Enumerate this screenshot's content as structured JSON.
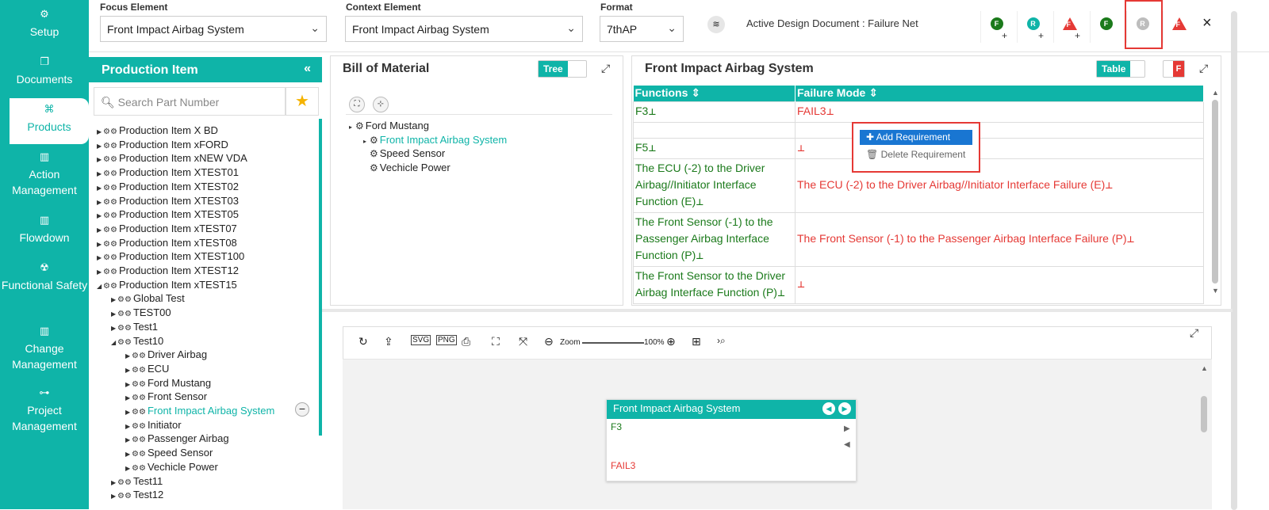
{
  "nav": {
    "items": [
      {
        "label": "Setup",
        "icon": "cogs-icon"
      },
      {
        "label": "Documents",
        "icon": "documents-icon"
      },
      {
        "label": "Products",
        "icon": "products-icon"
      },
      {
        "label": "Action Management",
        "icon": "building-icon"
      },
      {
        "label": "Flowdown",
        "icon": "building-icon"
      },
      {
        "label": "Functional Safety",
        "icon": "safety-icon"
      },
      {
        "label": "Change Management",
        "icon": "building-icon"
      },
      {
        "label": "Project Management",
        "icon": "network-icon"
      }
    ]
  },
  "topbar": {
    "focus_label": "Focus Element",
    "focus_value": "Front Impact Airbag System",
    "context_label": "Context Element",
    "context_value": "Front Impact Airbag System",
    "format_label": "Format",
    "format_value": "7thAP",
    "active_doc": "Active Design Document : Failure Net",
    "buttons": [
      {
        "letter": "F",
        "color": "#1b7a1b",
        "kind": "circle",
        "plus": "+"
      },
      {
        "letter": "R",
        "color": "#0fb4a8",
        "kind": "circle",
        "plus": "+"
      },
      {
        "letter": "F",
        "color": "#e53935",
        "kind": "triangle",
        "plus": "+"
      },
      {
        "letter": "F",
        "color": "#1b7a1b",
        "kind": "circle",
        "plus": ""
      },
      {
        "letter": "R",
        "color": "#bdbdbd",
        "kind": "circle",
        "plus": ""
      },
      {
        "letter": "F",
        "color": "#e53935",
        "kind": "triangle",
        "plus": ""
      }
    ],
    "close": "×"
  },
  "production": {
    "title": "Production Item",
    "collapse": "«",
    "search_placeholder": "Search Part Number",
    "tree": [
      {
        "label": "Production Item X BD",
        "level": 0,
        "expanded": false
      },
      {
        "label": "Production Item xFORD",
        "level": 0,
        "expanded": false
      },
      {
        "label": "Production Item xNEW VDA",
        "level": 0,
        "expanded": false
      },
      {
        "label": "Production Item XTEST01",
        "level": 0,
        "expanded": false
      },
      {
        "label": "Production Item XTEST02",
        "level": 0,
        "expanded": false
      },
      {
        "label": "Production Item XTEST03",
        "level": 0,
        "expanded": false
      },
      {
        "label": "Production Item XTEST05",
        "level": 0,
        "expanded": false
      },
      {
        "label": "Production Item xTEST07",
        "level": 0,
        "expanded": false
      },
      {
        "label": "Production Item xTEST08",
        "level": 0,
        "expanded": false
      },
      {
        "label": "Production Item XTEST100",
        "level": 0,
        "expanded": false
      },
      {
        "label": "Production Item XTEST12",
        "level": 0,
        "expanded": false
      },
      {
        "label": "Production Item xTEST15",
        "level": 0,
        "expanded": true
      },
      {
        "label": "Global Test",
        "level": 1,
        "expanded": false
      },
      {
        "label": "TEST00",
        "level": 1,
        "expanded": false
      },
      {
        "label": "Test1",
        "level": 1,
        "expanded": false
      },
      {
        "label": "Test10",
        "level": 1,
        "expanded": true
      },
      {
        "label": "Driver Airbag",
        "level": 2,
        "expanded": false
      },
      {
        "label": "ECU",
        "level": 2,
        "expanded": false
      },
      {
        "label": "Ford Mustang",
        "level": 2,
        "expanded": false
      },
      {
        "label": "Front Sensor",
        "level": 2,
        "expanded": false
      },
      {
        "label": "Front Impact Airbag System",
        "level": 2,
        "expanded": false,
        "selected": true
      },
      {
        "label": "Initiator",
        "level": 2,
        "expanded": false
      },
      {
        "label": "Passenger Airbag",
        "level": 2,
        "expanded": false
      },
      {
        "label": "Speed Sensor",
        "level": 2,
        "expanded": false
      },
      {
        "label": "Vechicle Power",
        "level": 2,
        "expanded": false
      },
      {
        "label": "Test11",
        "level": 1,
        "expanded": false
      },
      {
        "label": "Test12",
        "level": 1,
        "expanded": false
      }
    ]
  },
  "bom": {
    "title": "Bill of Material",
    "toggle_label": "Tree",
    "tree": [
      {
        "label": "Ford Mustang",
        "level": 0
      },
      {
        "label": "Front Impact Airbag System",
        "level": 1,
        "selected": true
      },
      {
        "label": "Speed Sensor",
        "level": 1
      },
      {
        "label": "Vechicle Power",
        "level": 1
      }
    ]
  },
  "fn": {
    "title": "Front Impact Airbag System",
    "toggle_label": "Table",
    "flag": "F",
    "headers": [
      "Functions",
      "Failure Mode"
    ],
    "rows": [
      {
        "function": "F3",
        "failure": "FAIL3"
      },
      {
        "function": "",
        "failure": ""
      },
      {
        "function": "F5",
        "failure": ""
      },
      {
        "function": "The ECU (-2) to the Driver Airbag//Initiator Interface Function (E)",
        "failure": "The ECU (-2) to the Driver Airbag//Initiator Interface Failure (E)"
      },
      {
        "function": "The Front Sensor (-1) to the Passenger Airbag Interface Function (P)",
        "failure": "The Front Sensor (-1) to the Passenger Airbag Interface Failure (P)"
      },
      {
        "function": "The Front Sensor to the Driver Airbag Interface Function (P)",
        "failure": ""
      }
    ],
    "context_menu": {
      "add": "Add Requirement",
      "delete": "Delete Requirement"
    }
  },
  "net": {
    "zoom_label": "Zoom",
    "zoom_value": "100%",
    "node": {
      "title": "Front Impact Airbag System",
      "function": "F3",
      "failure": "FAIL3"
    }
  }
}
